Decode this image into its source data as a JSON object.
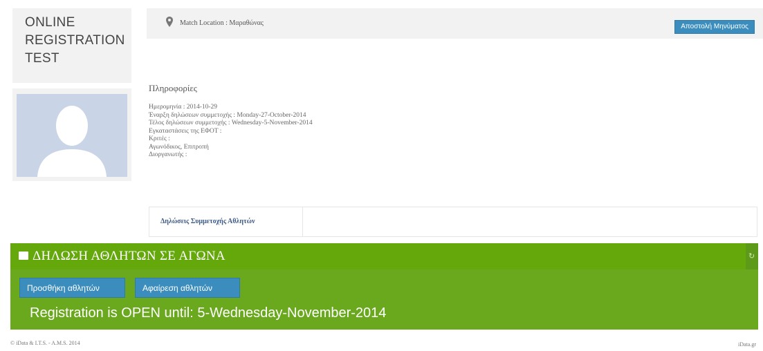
{
  "event": {
    "title_lines": [
      "ONLINE",
      "REGISTRATION",
      "TEST"
    ]
  },
  "location": {
    "icon": "map-pin-icon",
    "text": "Match Location : Μαραθώνας"
  },
  "header_button": "Αποστολή Μηνύματος",
  "info": {
    "heading": "Πληροφορίες",
    "lines": [
      "Ημερομηνία : 2014-10-29",
      "Έναρξη δηλώσεων συμμετοχής : Monday-27-October-2014",
      "Τέλος δηλώσεων συμμετοχής : Wednesday-5-November-2014",
      "Εγκαταστάσεις της ΕΦΟΤ :",
      "Κριτές :",
      "Αγωνόδικος, Επιτροπή",
      "Διοργανωτής :"
    ]
  },
  "tab": {
    "label": "Δηλώσεις Συμμετοχής Αθλητών"
  },
  "panel": {
    "title": "ΔΗΛΩΣΗ ΑΘΛΗΤΩΝ ΣΕ ΑΓΩΝΑ",
    "add_button": "Προσθήκη αθλητών",
    "remove_button": "Αφαίρεση αθλητών",
    "status": "Registration is OPEN until: 5-Wednesday-November-2014",
    "color": "#6aa81e"
  },
  "footer": {
    "left": "© iData & I.T.S. - A.M.S. 2014",
    "right": "iData.gr"
  }
}
